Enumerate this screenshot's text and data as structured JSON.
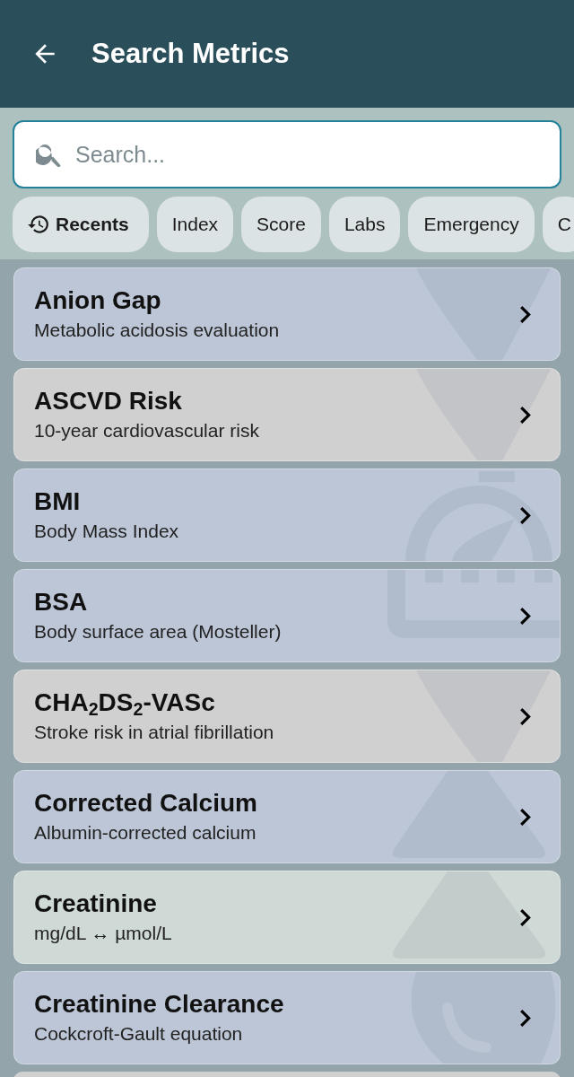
{
  "header": {
    "title": "Search Metrics"
  },
  "search": {
    "placeholder": "Search..."
  },
  "chips": [
    {
      "label": "Recents",
      "kind": "history",
      "selected": true
    },
    {
      "label": "Index",
      "kind": "plain",
      "selected": false
    },
    {
      "label": "Score",
      "kind": "plain",
      "selected": false
    },
    {
      "label": "Labs",
      "kind": "plain",
      "selected": false
    },
    {
      "label": "Emergency",
      "kind": "plain",
      "selected": false
    },
    {
      "label": "C",
      "kind": "plain",
      "selected": false
    }
  ],
  "metrics": [
    {
      "title": "Anion Gap",
      "subtitle": "Metabolic acidosis evaluation",
      "color": "#bcc6d6",
      "kind": "drop"
    },
    {
      "title": "ASCVD Risk",
      "subtitle": "10-year cardiovascular risk",
      "color": "#d0d0d0",
      "kind": "drop"
    },
    {
      "title": "BMI",
      "subtitle": "Body Mass Index",
      "color": "#bcc6d6",
      "kind": "gauge"
    },
    {
      "title": "BSA",
      "subtitle": "Body surface area (Mosteller)",
      "color": "#bcc6d6",
      "kind": "ruler"
    },
    {
      "title": "CHA$_{2}$DS$_{2}$-VASc",
      "subtitle": "Stroke risk in atrial fibrillation",
      "color": "#d0d0d0",
      "kind": "drop"
    },
    {
      "title": "Corrected Calcium",
      "subtitle": "Albumin-corrected calcium",
      "color": "#bcc6d6",
      "kind": "triangle"
    },
    {
      "title": "Creatinine",
      "subtitle": "mg/dL ↔ µmol/L",
      "color": "#cfd9d5",
      "kind": "triangle"
    },
    {
      "title": "Creatinine Clearance",
      "subtitle": "Cockcroft-Gault equation",
      "color": "#bcc6d6",
      "kind": "circle"
    }
  ]
}
